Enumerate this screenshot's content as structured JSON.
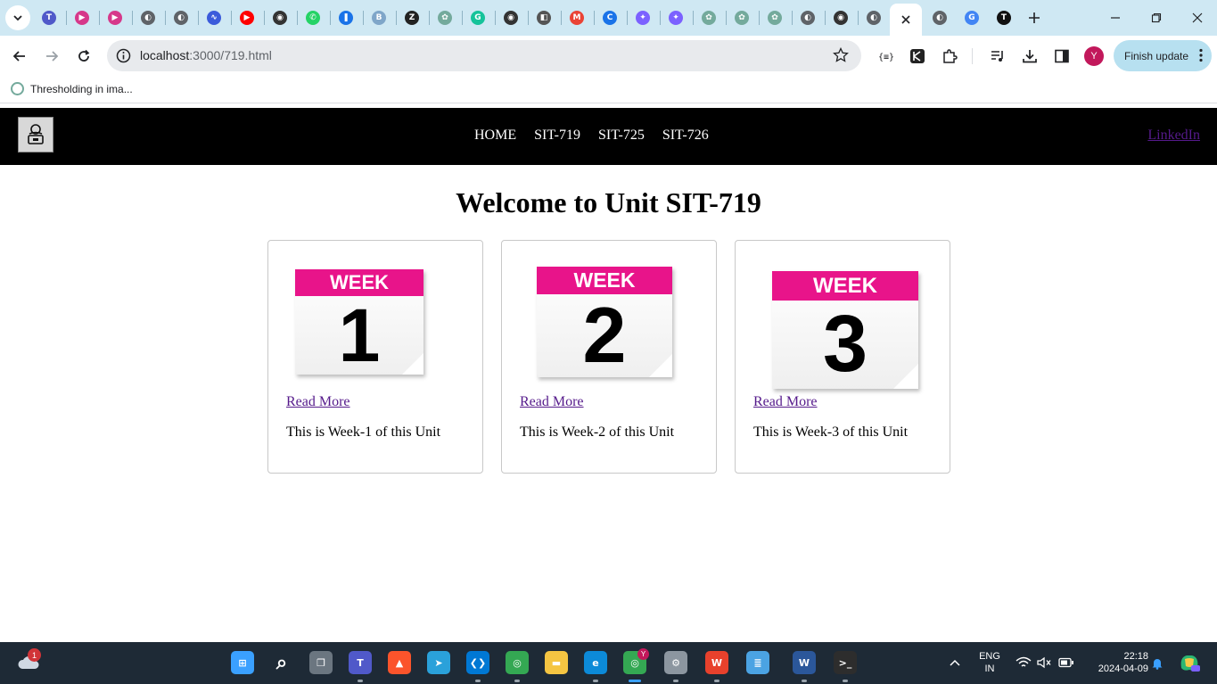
{
  "browser": {
    "url_host": "localhost",
    "url_path": ":3000/719.html",
    "finish_update_label": "Finish update",
    "profile_initial": "Y",
    "bookmark_label": "Thresholding in ima...",
    "accent_color": "#cfe8f3"
  },
  "pinned_tabs": [
    {
      "icon": "teams-icon",
      "color": "#5059c9",
      "glyph": "T"
    },
    {
      "icon": "video-play-icon",
      "color": "#d6388a",
      "glyph": "▶"
    },
    {
      "icon": "video-play-icon",
      "color": "#d6388a",
      "glyph": "▶"
    },
    {
      "icon": "globe-icon",
      "color": "#5f6368",
      "glyph": "◐"
    },
    {
      "icon": "globe-icon",
      "color": "#5f6368",
      "glyph": "◐"
    },
    {
      "icon": "wave-icon",
      "color": "#3b5bdb",
      "glyph": "∿"
    },
    {
      "icon": "youtube-icon",
      "color": "#ff0000",
      "glyph": "▶"
    },
    {
      "icon": "openai-icon",
      "color": "#333333",
      "glyph": "◉"
    },
    {
      "icon": "whatsapp-icon",
      "color": "#25d366",
      "glyph": "✆"
    },
    {
      "icon": "bookmark-icon",
      "color": "#1a73e8",
      "glyph": "❚"
    },
    {
      "icon": "bing-icon",
      "color": "#7fa6c9",
      "glyph": "B"
    },
    {
      "icon": "dark-z-icon",
      "color": "#222222",
      "glyph": "Z"
    },
    {
      "icon": "chatgpt-icon",
      "color": "#74aa9c",
      "glyph": "✿"
    },
    {
      "icon": "grammarly-icon",
      "color": "#15c39a",
      "glyph": "G"
    },
    {
      "icon": "openai-icon",
      "color": "#333333",
      "glyph": "◉"
    },
    {
      "icon": "notebook-icon",
      "color": "#555555",
      "glyph": "◧"
    },
    {
      "icon": "gmail-icon",
      "color": "#ea4335",
      "glyph": "M"
    },
    {
      "icon": "copilot-icon",
      "color": "#1a73e8",
      "glyph": "C"
    },
    {
      "icon": "badge-icon",
      "color": "#7b61ff",
      "glyph": "✦"
    },
    {
      "icon": "badge-icon",
      "color": "#7b61ff",
      "glyph": "✦"
    },
    {
      "icon": "chatgpt-icon",
      "color": "#74aa9c",
      "glyph": "✿"
    },
    {
      "icon": "chatgpt-icon",
      "color": "#74aa9c",
      "glyph": "✿"
    },
    {
      "icon": "chatgpt-icon",
      "color": "#74aa9c",
      "glyph": "✿"
    },
    {
      "icon": "globe-icon",
      "color": "#5f6368",
      "glyph": "◐"
    },
    {
      "icon": "openai-icon",
      "color": "#333333",
      "glyph": "◉"
    },
    {
      "icon": "globe-icon",
      "color": "#5f6368",
      "glyph": "◐"
    }
  ],
  "trailing_tabs": [
    {
      "icon": "globe-icon",
      "color": "#5f6368",
      "glyph": "◐"
    },
    {
      "icon": "google-icon",
      "color": "#4285f4",
      "glyph": "G"
    },
    {
      "icon": "tsv-icon",
      "color": "#111111",
      "glyph": "T"
    }
  ],
  "site": {
    "nav_links": [
      "HOME",
      "SIT-719",
      "SIT-725",
      "SIT-726"
    ],
    "linkedin_label": "LinkedIn",
    "page_title": "Welcome to Unit SIT-719",
    "brand_pink": "#e8148a",
    "link_color": "#551a8b"
  },
  "cards": [
    {
      "week_label": "WEEK",
      "week_number": "1",
      "link_label": "Read More",
      "description": "This is Week-1 of this Unit"
    },
    {
      "week_label": "WEEK",
      "week_number": "2",
      "link_label": "Read More",
      "description": "This is Week-2 of this Unit"
    },
    {
      "week_label": "WEEK",
      "week_number": "3",
      "link_label": "Read More",
      "description": "This is Week-3 of this Unit"
    }
  ],
  "taskbar": {
    "notification_count": "1",
    "language_line1": "ENG",
    "language_line2": "IN",
    "time": "22:18",
    "date": "2024-04-09",
    "chrome_badge": "Y"
  },
  "taskbar_apps": [
    {
      "name": "windows-start-icon",
      "color": "#3aa0ff",
      "glyph": "⊞"
    },
    {
      "name": "search-icon",
      "color": "transparent",
      "glyph": "⌕"
    },
    {
      "name": "task-view-icon",
      "color": "#6b7680",
      "glyph": "❐"
    },
    {
      "name": "teams-icon",
      "color": "#5059c9",
      "glyph": "T"
    },
    {
      "name": "brave-icon",
      "color": "#fb542b",
      "glyph": "▲"
    },
    {
      "name": "telegram-icon",
      "color": "#2aa1da",
      "glyph": "➤"
    },
    {
      "name": "vscode-icon",
      "color": "#0078d4",
      "glyph": "❮❯"
    },
    {
      "name": "chrome-icon",
      "color": "#34a853",
      "glyph": "◎"
    },
    {
      "name": "file-explorer-icon",
      "color": "#f5c542",
      "glyph": "▬"
    },
    {
      "name": "edge-icon",
      "color": "#0c8ad8",
      "glyph": "e"
    },
    {
      "name": "chrome-profile-icon",
      "color": "#34a853",
      "glyph": "◎"
    },
    {
      "name": "settings-icon",
      "color": "#8c96a0",
      "glyph": "⚙"
    },
    {
      "name": "wps-office-icon",
      "color": "#e8412c",
      "glyph": "W"
    },
    {
      "name": "notepad-icon",
      "color": "#4ba3e3",
      "glyph": "≣"
    },
    {
      "name": "word-icon",
      "color": "#2b579a",
      "glyph": "W"
    },
    {
      "name": "terminal-icon",
      "color": "#2d2d2d",
      "glyph": ">_"
    }
  ]
}
